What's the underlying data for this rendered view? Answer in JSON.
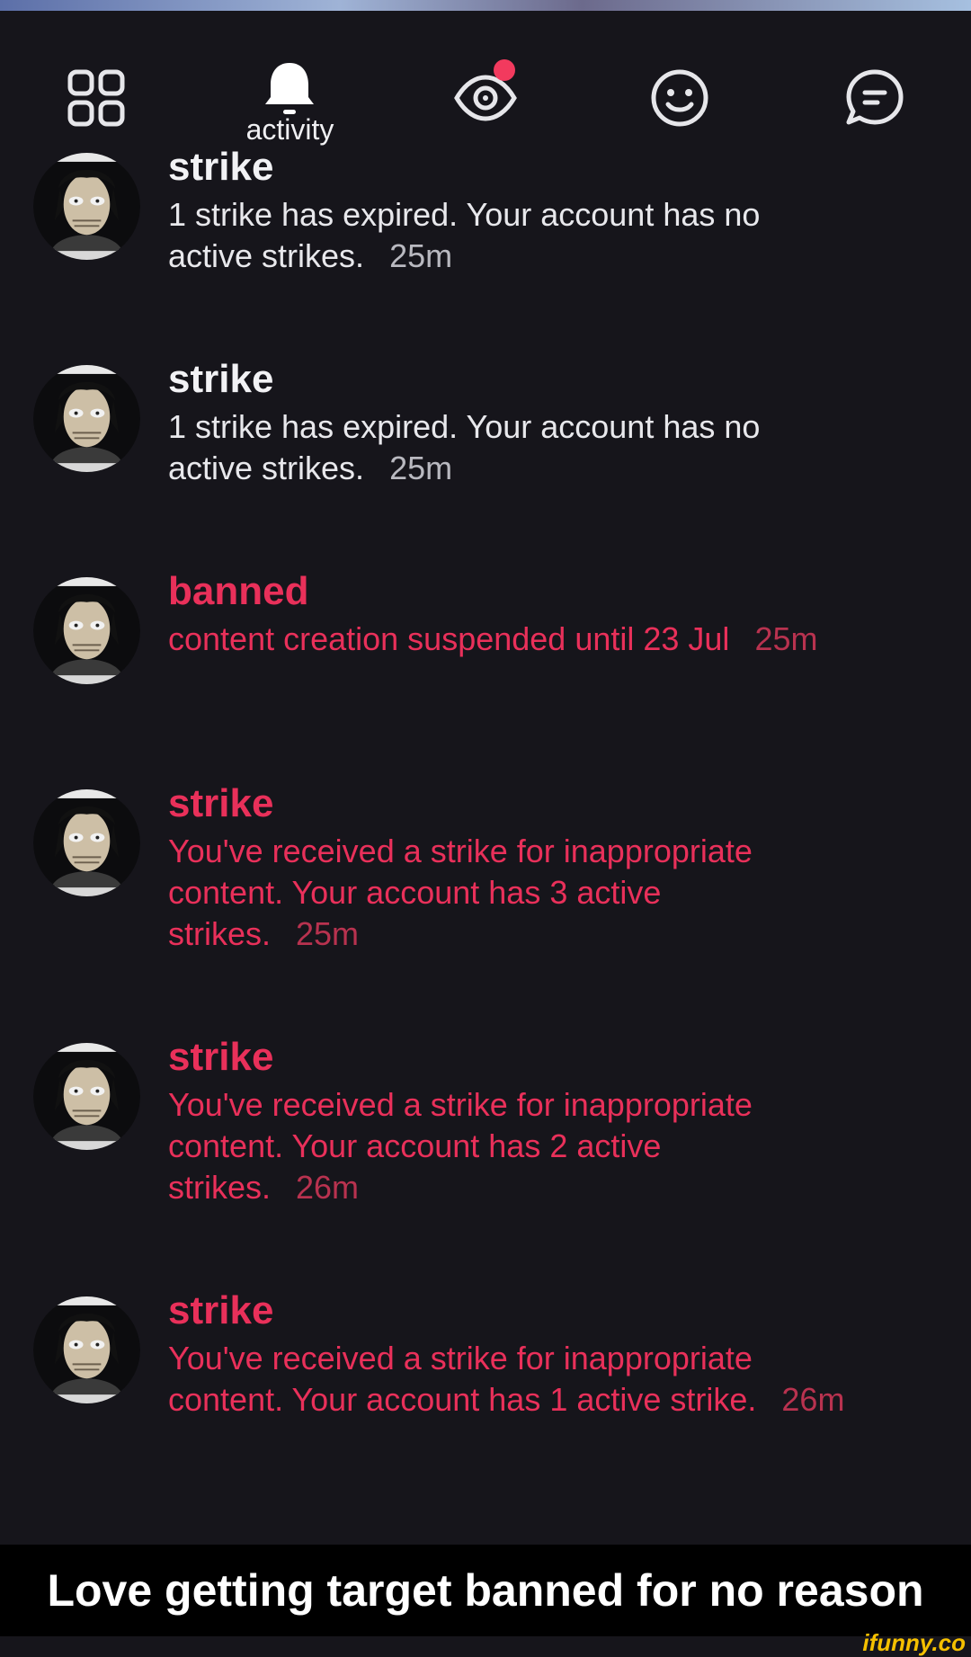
{
  "nav": {
    "tabs": [
      {
        "icon": "grid-icon",
        "label": ""
      },
      {
        "icon": "bell-icon",
        "label": "activity",
        "active": true
      },
      {
        "icon": "eye-icon",
        "label": "",
        "badge": true
      },
      {
        "icon": "smiley-icon",
        "label": ""
      },
      {
        "icon": "chat-icon",
        "label": ""
      }
    ]
  },
  "notifications": [
    {
      "title": "strike",
      "message": "1 strike has expired. Your account has no active strikes.",
      "time": "25m",
      "style": "neutral"
    },
    {
      "title": "strike",
      "message": "1 strike has expired. Your account has no active strikes.",
      "time": "25m",
      "style": "neutral"
    },
    {
      "title": "banned",
      "message": "content creation suspended until 23 Jul",
      "time": "25m",
      "style": "alert"
    },
    {
      "title": "strike",
      "message": "You've received a strike for inappropriate content. Your account has 3 active strikes.",
      "time": "25m",
      "style": "alert"
    },
    {
      "title": "strike",
      "message": "You've received a strike for inappropriate content. Your account has 2 active strikes.",
      "time": "26m",
      "style": "alert"
    },
    {
      "title": "strike",
      "message": "You've received a strike for inappropriate content. Your account has 1 active strike.",
      "time": "26m",
      "style": "alert"
    }
  ],
  "caption": "Love getting target banned for no reason",
  "watermark": "ifunny.co",
  "colors": {
    "background": "#16151b",
    "alert": "#e9305a",
    "badge": "#f23a5e"
  }
}
